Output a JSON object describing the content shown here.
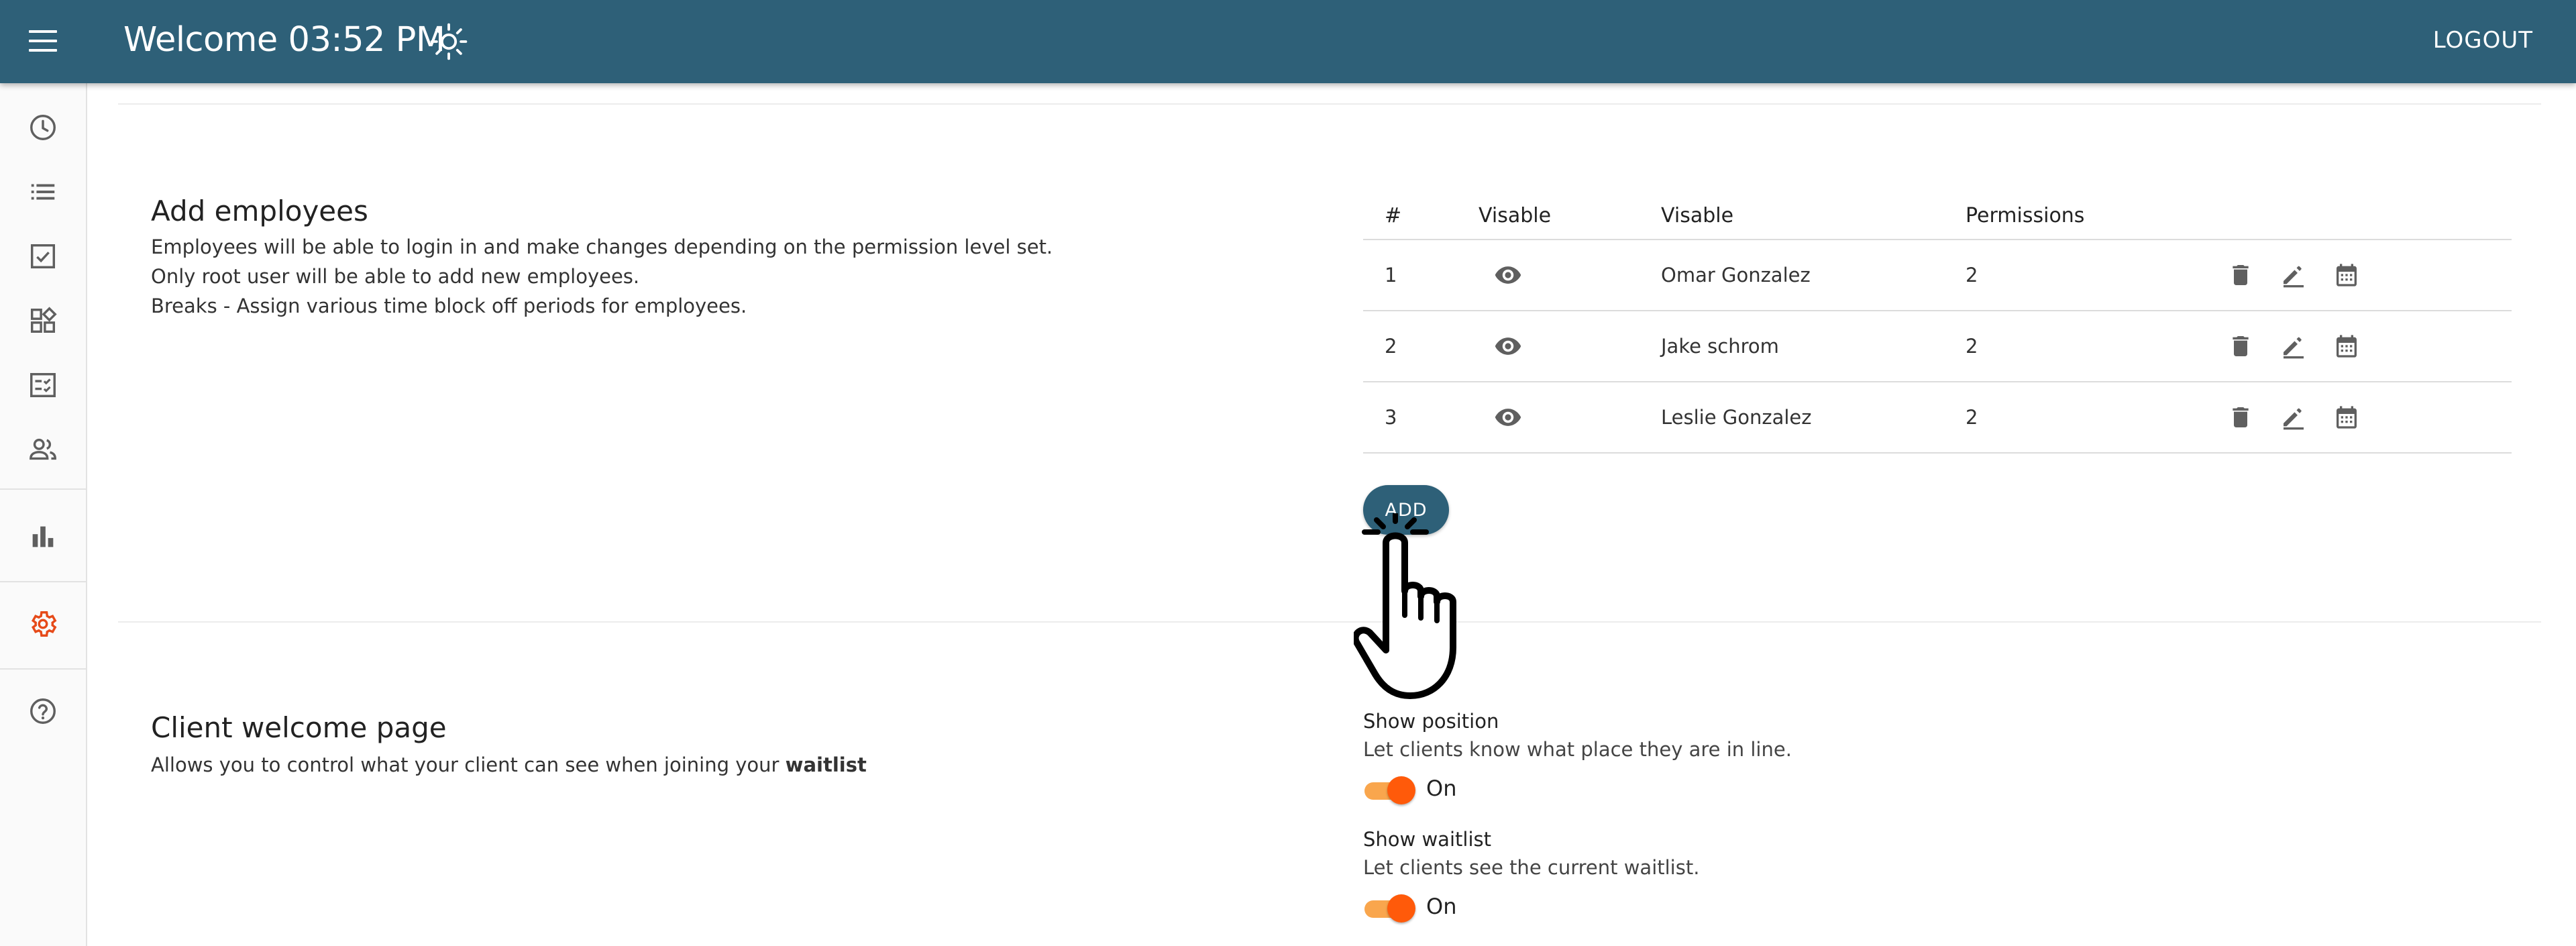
{
  "header": {
    "title": "Welcome 03:52 PM",
    "logout_label": "LOGOUT"
  },
  "sidebar": {
    "items": [
      {
        "icon": "clock-icon"
      },
      {
        "icon": "list-icon"
      },
      {
        "icon": "checkbox-icon"
      },
      {
        "icon": "widgets-icon"
      },
      {
        "icon": "checklist-icon"
      },
      {
        "icon": "people-icon"
      },
      {
        "icon": "bar-chart-icon"
      },
      {
        "icon": "settings-icon",
        "active": true,
        "color": "#e64a19"
      },
      {
        "icon": "help-icon"
      }
    ]
  },
  "employees_section": {
    "title": "Add employees",
    "description": [
      "Employees will be able to login in and make changes depending on the permission level set.",
      "Only root user will be able to add new employees.",
      "Breaks - Assign various time block off periods for employees."
    ],
    "table": {
      "headers": [
        "#",
        "Visable",
        "Visable",
        "Permissions"
      ],
      "rows": [
        {
          "num": "1",
          "name": "Omar Gonzalez",
          "permissions": "2"
        },
        {
          "num": "2",
          "name": "Jake schrom",
          "permissions": "2"
        },
        {
          "num": "3",
          "name": "Leslie Gonzalez",
          "permissions": "2"
        }
      ]
    },
    "add_label": "ADD"
  },
  "client_section": {
    "title": "Client welcome page",
    "description_prefix": "Allows you to control what your client can see when joining your ",
    "description_bold": "waitlist",
    "options": [
      {
        "title": "Show position",
        "description": "Let clients know what place they are in line.",
        "state": "On"
      },
      {
        "title": "Show waitlist",
        "description": "Let clients see the current waitlist.",
        "state": "On"
      }
    ]
  },
  "colors": {
    "primary": "#2e6078",
    "accent": "#ff5a0a",
    "accent_track": "#f9a64d"
  }
}
